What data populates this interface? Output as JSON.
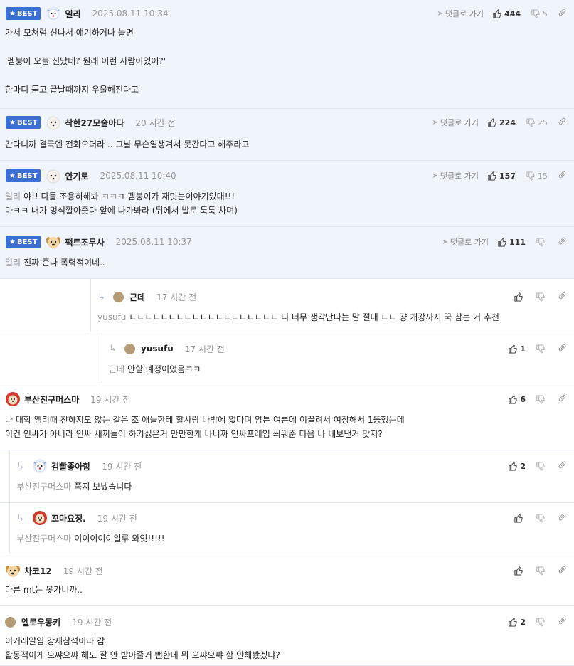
{
  "ui": {
    "best_label": "BEST",
    "goto_label": "댓글로 가기"
  },
  "comments": [
    {
      "best": true,
      "nick": "일리",
      "time": "2025.08.11 10:34",
      "avatar": "dog-icon",
      "likes": "444",
      "dislikes": "5",
      "goto": true,
      "lines": [
        "가서 모처럼 신나서 얘기하거나 놀면",
        "",
        "'펨붕이 오늘 신났네? 원래 이런 사람이었어?'",
        "",
        "한마디 듣고 끝날때까지 우울해진다고"
      ],
      "mention": ""
    },
    {
      "best": true,
      "nick": "착한27모술아다",
      "time": "20 시간 전",
      "avatar": "white-dog-icon",
      "likes": "224",
      "dislikes": "25",
      "goto": true,
      "lines": [
        "간다니까 결국엔 전화오더라 .. 그날 무슨일생겨서 못간다고 해주라고"
      ],
      "mention": ""
    },
    {
      "best": true,
      "nick": "얀기로",
      "time": "2025.08.11 10:40",
      "avatar": "white-dog-icon",
      "likes": "157",
      "dislikes": "15",
      "goto": true,
      "lines": [
        "야!! 다들 조용히해봐 ㅋㅋㅋ 펨붕이가 재밋는이야기있대!!!",
        "마ㅋㅋ 내가 멍석깔아줏다 앞에 나가봐라 (뒤에서 발로 툭툭 차며)"
      ],
      "mention": "일리"
    },
    {
      "best": true,
      "nick": "팩트조무사",
      "time": "2025.08.11 10:37",
      "avatar": "puppy-icon",
      "likes": "111",
      "dislikes": "",
      "goto": true,
      "lines": [
        "진짜 존나 폭력적이네.."
      ],
      "mention": "일리"
    },
    {
      "best": false,
      "nick": "근데",
      "time": "17 시간 전",
      "avatar": "dot-avatar",
      "likes": "",
      "dislikes": "",
      "goto": false,
      "depth": 1,
      "lines": [
        "ㄴㄴㄴㄴㄴㄴㄴㄴㄴㄴㄴㄴㄴㄴㄴㄴㄴㄴㄴ 니 너무 생각난다는 말 절대 ㄴㄴ 걍 개강까지 꾹 참는 거 추천"
      ],
      "mention": "yusufu"
    },
    {
      "best": false,
      "nick": "yusufu",
      "time": "17 시간 전",
      "avatar": "dot-avatar",
      "likes": "1",
      "dislikes": "",
      "goto": false,
      "depth": 2,
      "lines": [
        "안할 예정이었음ㅋㅋ"
      ],
      "mention": "근데"
    },
    {
      "best": false,
      "nick": "부산진구머스마",
      "time": "19 시간 전",
      "avatar": "red-dog-icon",
      "likes": "6",
      "dislikes": "",
      "goto": false,
      "depth": 0,
      "lines": [
        "나 대학 엠티때 친하지도 않는 같은 조 애들한테 할사람 나밖에 없다며 암튼 여른에 이끌려서 여장해서 1등했는데",
        "이건 인싸가 아니라 인싸 새끼들이 하기싫은거 만만한게 나니까 인싸프레임 씌워준 다음 나 내보낸거 맞지?"
      ],
      "mention": ""
    },
    {
      "best": false,
      "nick": "검빨좋아함",
      "time": "19 시간 전",
      "avatar": "dog-icon",
      "likes": "2",
      "dislikes": "",
      "goto": false,
      "depth": 3,
      "lines": [
        "쪽지 보냈습니다"
      ],
      "mention": "부산진구머스마"
    },
    {
      "best": false,
      "nick": "꼬마요정.",
      "time": "19 시간 전",
      "avatar": "red-dog-icon",
      "likes": "",
      "dislikes": "",
      "goto": false,
      "depth": 3,
      "lines": [
        "이이이이이일루 와잇!!!!!"
      ],
      "mention": "부산진구머스마"
    },
    {
      "best": false,
      "nick": "차코12",
      "time": "19 시간 전",
      "avatar": "puppy-icon",
      "likes": "",
      "dislikes": "",
      "goto": false,
      "depth": 0,
      "lines": [
        "다른 mt는 못가니까.."
      ],
      "mention": ""
    },
    {
      "best": false,
      "nick": "엘로우몽키",
      "time": "19 시간 전",
      "avatar": "dot-avatar",
      "likes": "2",
      "dislikes": "",
      "goto": false,
      "depth": 0,
      "lines": [
        "이거레알임 강제참석이라 감",
        "활동적이게 으쌰으쌰 해도 잘 안 받아줄거 뻔한데 뭐 으쌰으쌰 함 안해봤겠냐?"
      ],
      "mention": ""
    }
  ]
}
